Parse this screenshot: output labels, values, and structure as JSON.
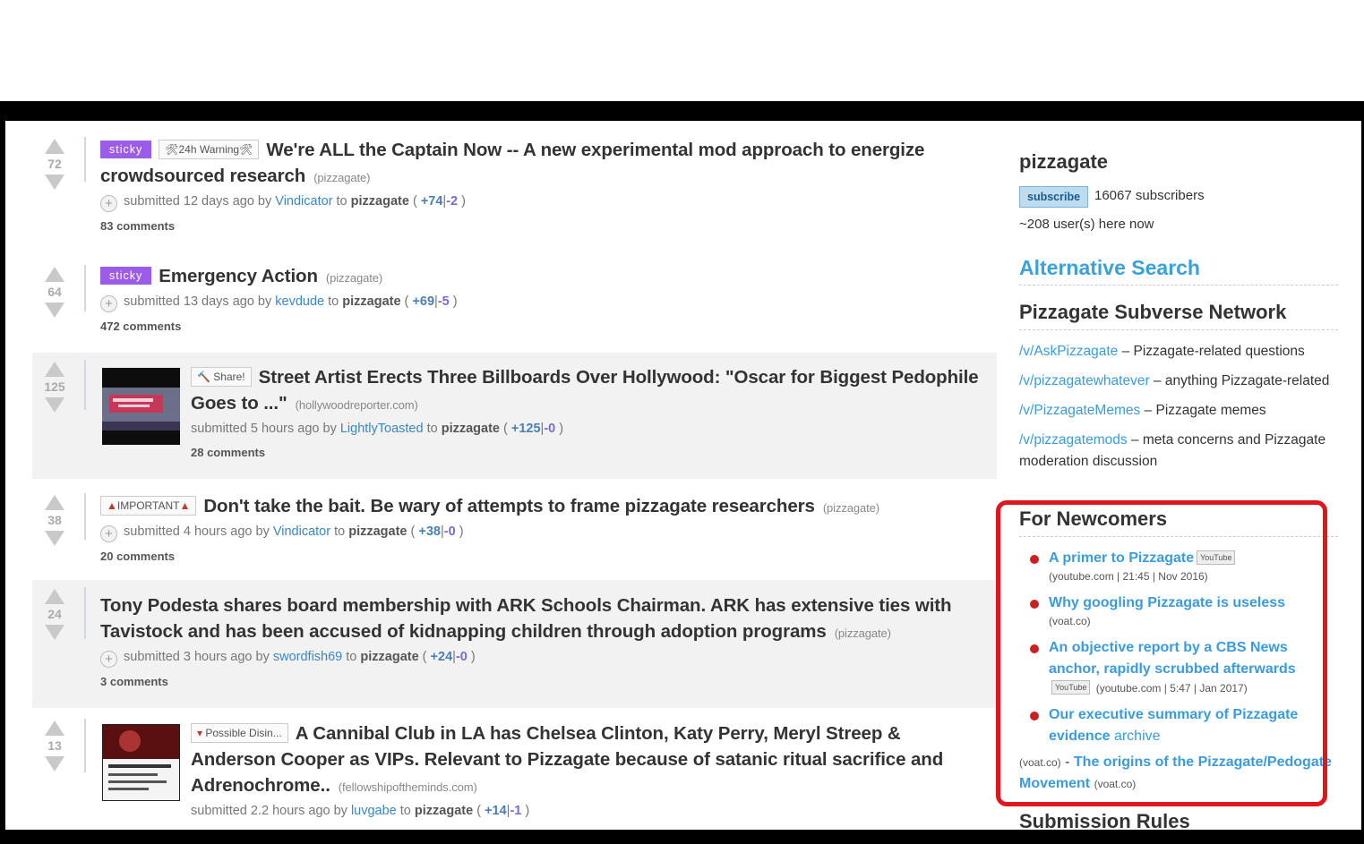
{
  "submissions": [
    {
      "score": "72",
      "tags": [
        {
          "kind": "sticky",
          "label": "sticky"
        },
        {
          "kind": "flair",
          "label": "🛠24h Warning🛠"
        }
      ],
      "title": "We're ALL the Captain Now -- A new experimental mod approach to energize crowdsourced research",
      "domain": "(pizzagate)",
      "submitted": "submitted 12 days ago by",
      "user": "Vindicator",
      "to": "to",
      "sub": "pizzagate",
      "up": "+74",
      "down": "-2",
      "comments": "83 comments"
    },
    {
      "score": "64",
      "tags": [
        {
          "kind": "sticky",
          "label": "sticky"
        }
      ],
      "title": "Emergency Action",
      "domain": "(pizzagate)",
      "submitted": "submitted 13 days ago by",
      "user": "kevdude",
      "to": "to",
      "sub": "pizzagate",
      "up": "+69",
      "down": "-5",
      "comments": "472 comments"
    },
    {
      "score": "125",
      "tags": [
        {
          "kind": "flair",
          "label": "🔨 Share!"
        }
      ],
      "title": "Street Artist Erects Three Billboards Over Hollywood: \"Oscar for Biggest Pedophile Goes to ...\"",
      "domain": "(hollywoodreporter.com)",
      "submitted": "submitted 5 hours ago by",
      "user": "LightlyToasted",
      "to": "to",
      "sub": "pizzagate",
      "up": "+125",
      "down": "-0",
      "comments": "28 comments"
    },
    {
      "score": "38",
      "tags": [
        {
          "kind": "flair",
          "label": "IMPORTANT"
        }
      ],
      "title": "Don't take the bait. Be wary of attempts to frame pizzagate researchers",
      "domain": "(pizzagate)",
      "submitted": "submitted 4 hours ago by",
      "user": "Vindicator",
      "to": "to",
      "sub": "pizzagate",
      "up": "+38",
      "down": "-0",
      "comments": "20 comments"
    },
    {
      "score": "24",
      "tags": [],
      "title": "Tony Podesta shares board membership with ARK Schools Chairman. ARK has extensive ties with Tavistock and has been accused of kidnapping children through adoption programs",
      "domain": "(pizzagate)",
      "submitted": "submitted 3 hours ago by",
      "user": "swordfish69",
      "to": "to",
      "sub": "pizzagate",
      "up": "+24",
      "down": "-0",
      "comments": "3 comments"
    },
    {
      "score": "13",
      "tags": [
        {
          "kind": "flair",
          "label": "Possible Disin..."
        }
      ],
      "title": "A Cannibal Club in LA has Chelsea Clinton, Katy Perry, Meryl Streep & Anderson Cooper as VIPs. Relevant to Pizzagate because of satanic ritual sacrifice and Adrenochrome..",
      "domain": "(fellowshipoftheminds.com)",
      "submitted": "submitted 2.2 hours ago by",
      "user": "luvgabe",
      "to": "to",
      "sub": "pizzagate",
      "up": "+14",
      "down": "-1",
      "comments": ""
    }
  ],
  "sidebar": {
    "name": "pizzagate",
    "subscribe": "subscribe",
    "subscribers": "16067 subscribers",
    "here_now": "~208 user(s) here now",
    "alt_search": "Alternative Search",
    "network_heading": "Pizzagate Subverse Network",
    "network": [
      {
        "link": "/v/AskPizzagate",
        "desc": " – Pizzagate-related questions"
      },
      {
        "link": "/v/pizzagatewhatever",
        "desc": " – anything Pizzagate-related"
      },
      {
        "link": "/v/PizzagateMemes",
        "desc": " – Pizzagate memes"
      },
      {
        "link": "/v/pizzagatemods",
        "desc": " – meta concerns and Pizzagate moderation discussion"
      }
    ],
    "newcomers_heading": "For Newcomers",
    "newcomers": [
      {
        "title": "A primer to Pizzagate",
        "badge": "YouTube",
        "meta": "(youtube.com | 21:45 | Nov 2016)"
      },
      {
        "title": "Why googling Pizzagate is useless",
        "badge": "",
        "meta": "(voat.co)"
      },
      {
        "title": "An objective report by a CBS News anchor, rapidly scrubbed afterwards",
        "badge": "YouTube",
        "meta": "(youtube.com | 5:47 | Jan 2017)"
      },
      {
        "title": "Our executive summary of Pizzagate evidence",
        "archive": "archive",
        "badge": "",
        "meta": ""
      }
    ],
    "origins_prefix": "(voat.co)",
    "origins_sep": " - ",
    "origins_title": "The origins of the Pizzagate/Pedogate Movement",
    "origins_suffix": "(voat.co)",
    "rules_heading": "Submission Rules"
  },
  "colors": {
    "sticky": "#9b5de5",
    "link": "#3b86c4",
    "highlight_box": "#e0161e"
  }
}
